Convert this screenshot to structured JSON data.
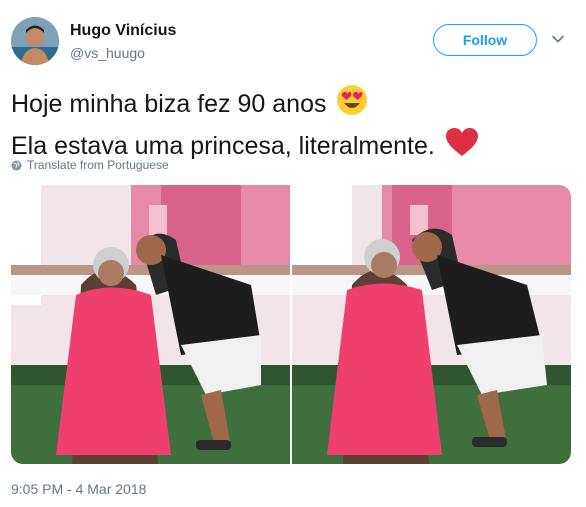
{
  "tweet": {
    "author": {
      "name": "Hugo Vinícius",
      "handle": "@vs_huugo",
      "avatar_icon": "profile-avatar"
    },
    "follow_label": "Follow",
    "text_line1": "Hoje minha biza fez 90 anos",
    "text_line2": "Ela estava uma princesa, literalmente.",
    "emoji_line1": "heart-eyes-emoji",
    "emoji_line2": "red-heart-emoji",
    "translate_label": "Translate from Portuguese",
    "timestamp": "9:05 PM - 4 Mar 2018",
    "colors": {
      "accent": "#1da1f2",
      "text": "#14171a",
      "muted": "#657786",
      "dress": "#ee3f6e",
      "heart": "#dd2e44"
    }
  }
}
